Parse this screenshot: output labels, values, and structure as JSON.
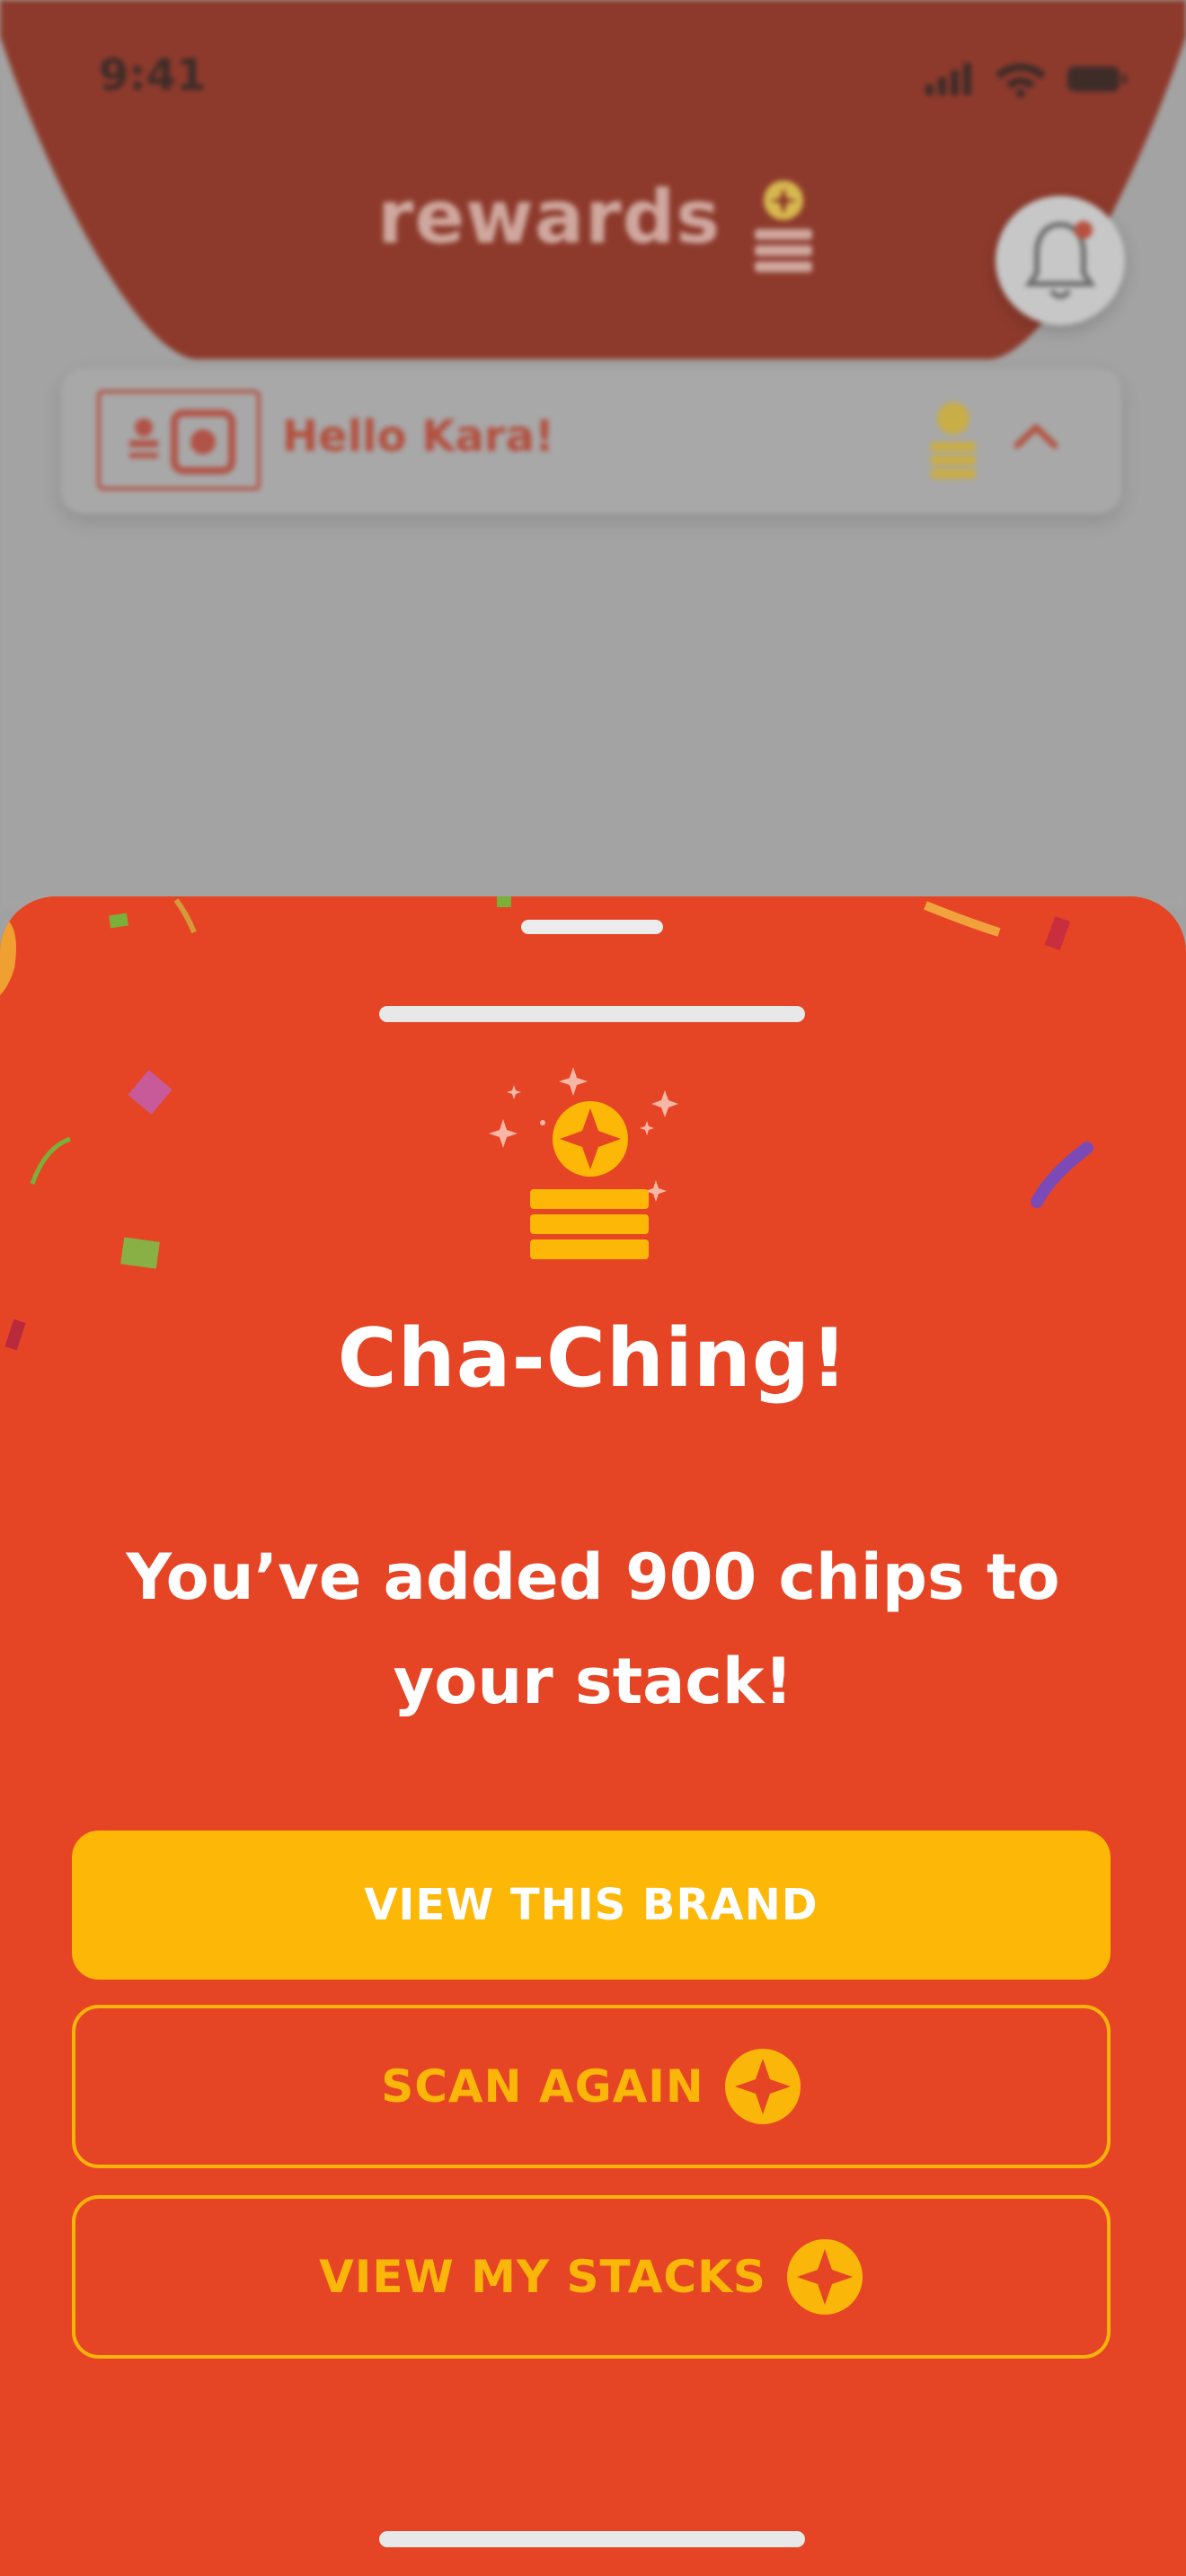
{
  "status_bar": {
    "time": "9:41"
  },
  "header": {
    "brand_text": "rewards",
    "brand_color": "#c5412b"
  },
  "user_card": {
    "greeting": "Hello Kara!"
  },
  "sheet": {
    "background": "#e64525",
    "headline": "Cha-Ching!",
    "message": "You’ve added 900 chips to your stack!",
    "buttons": {
      "view_brand": "VIEW THIS BRAND",
      "scan_again": "SCAN AGAIN",
      "view_stacks": "VIEW MY STACKS"
    },
    "accent": "#fdb707"
  },
  "icons": {
    "bell": "bell-icon",
    "chip_stack": "chip-stack-icon",
    "sparkle_coin": "sparkle-coin-icon",
    "chevron": "chevron-up-icon"
  }
}
